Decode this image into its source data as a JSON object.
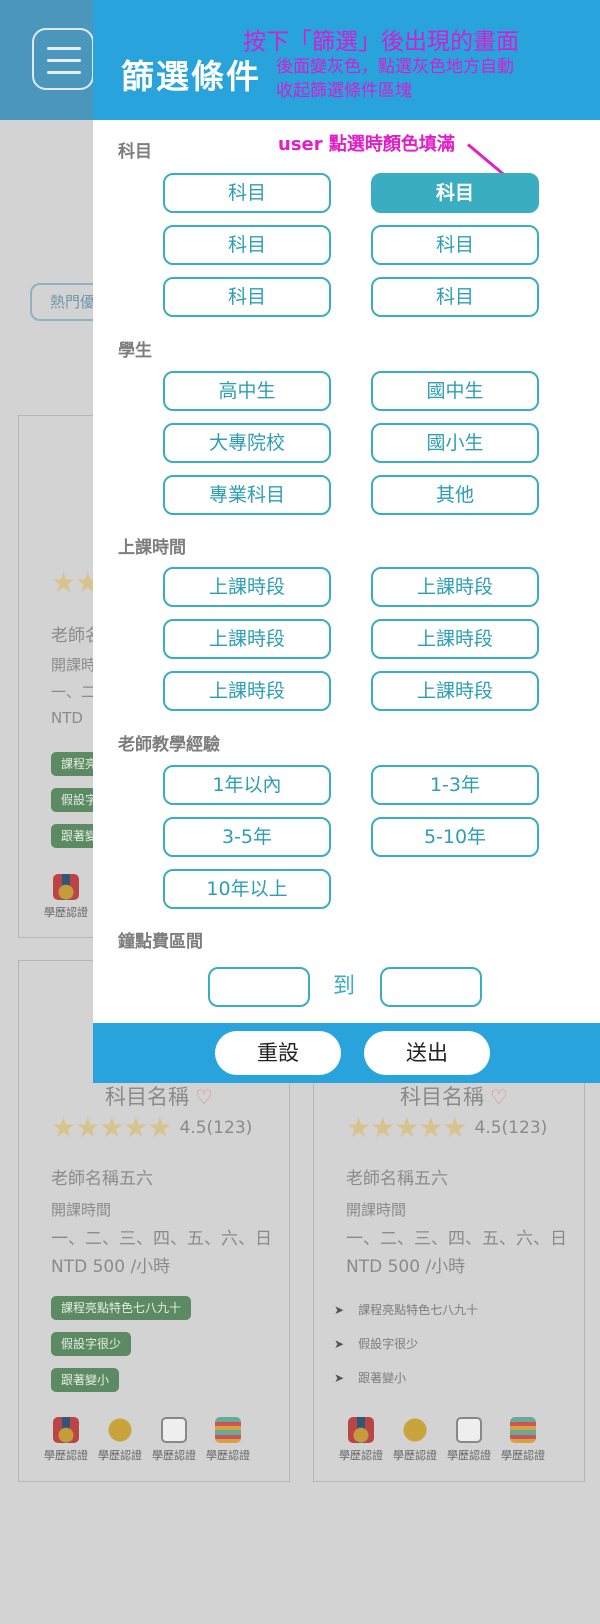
{
  "background": {
    "hot_pill": "熱門優",
    "cards_top": {
      "left_teacher": "老師名",
      "left_time": "開課時",
      "left_days": "一、二",
      "left_price": "NTD",
      "tags": [
        "課程亮",
        "假設字",
        "跟著變"
      ],
      "badge": "學歷認證"
    },
    "cards": [
      {
        "title": "科目名稱",
        "rating": "4.5(123)",
        "teacher": "老師名稱五六",
        "time_label": "開課時間",
        "days": "一、二、三、四、五、六、日",
        "price": "NTD  500 /小時",
        "tags": [
          "課程亮點特色七八九十",
          "假設字很少",
          "跟著變小"
        ],
        "badges": [
          "學歷認證",
          "學歷認證",
          "學歷認證",
          "學歷認證"
        ]
      },
      {
        "title": "科目名稱",
        "rating": "4.5(123)",
        "teacher": "老師名稱五六",
        "time_label": "開課時間",
        "days": "一、二、三、四、五、六、日",
        "price": "NTD  500 /小時",
        "bullets": [
          "課程亮點特色七八九十",
          "假設字很少",
          "跟著變小"
        ],
        "badges": [
          "學歷認證",
          "學歷認證",
          "學歷認證",
          "學歷認證"
        ]
      }
    ]
  },
  "filter": {
    "title": "篩選條件",
    "annotation_main": "按下「篩選」後出現的畫面",
    "annotation_sub": [
      "後面變灰色，點選灰色地方自動",
      "收起篩選條件區塊"
    ],
    "annotation_user": "user 點選時顏色填滿",
    "sections": {
      "subject": {
        "label": "科目",
        "options": [
          "科目",
          "科目",
          "科目",
          "科目",
          "科目",
          "科目"
        ],
        "selected_index": 1
      },
      "student": {
        "label": "學生",
        "options": [
          "高中生",
          "國中生",
          "大專院校",
          "國小生",
          "專業科目",
          "其他"
        ]
      },
      "time": {
        "label": "上課時間",
        "options": [
          "上課時段",
          "上課時段",
          "上課時段",
          "上課時段",
          "上課時段",
          "上課時段"
        ]
      },
      "experience": {
        "label": "老師教學經驗",
        "options": [
          "1年以內",
          "1-3年",
          "3-5年",
          "5-10年",
          "10年以上"
        ]
      },
      "fee": {
        "label": "鐘點費區間",
        "to": "到",
        "min_value": "",
        "max_value": ""
      }
    },
    "reset_label": "重設",
    "submit_label": "送出"
  },
  "colors": {
    "header_blue": "#29a3dc",
    "accent_teal": "#3aaec0",
    "annotation_magenta": "#d21fd2",
    "tag_green": "#5c8a62",
    "star_gold": "#d7c38c"
  }
}
